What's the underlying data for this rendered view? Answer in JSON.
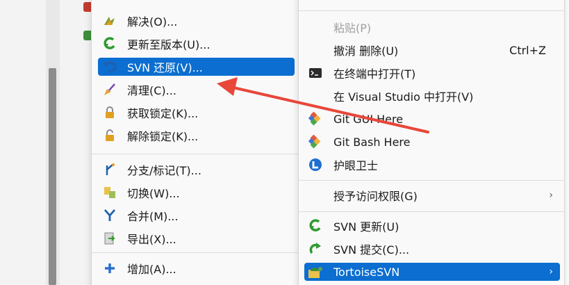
{
  "left_menu": {
    "items": [
      {
        "label": "解决(O)...",
        "icon": "resolve-icon"
      },
      {
        "label": "更新至版本(U)...",
        "icon": "update-to-revision-icon"
      },
      {
        "label": "SVN 还原(V)...",
        "icon": "revert-icon",
        "highlighted": true
      },
      {
        "label": "清理(C)...",
        "icon": "cleanup-broom-icon"
      },
      {
        "label": "获取锁定(K)...",
        "icon": "lock-icon"
      },
      {
        "label": "解除锁定(K)...",
        "icon": "unlock-icon"
      },
      {
        "label": "分支/标记(T)...",
        "icon": "branch-tag-icon"
      },
      {
        "label": "切换(W)...",
        "icon": "switch-icon"
      },
      {
        "label": "合并(M)...",
        "icon": "merge-icon"
      },
      {
        "label": "导出(X)...",
        "icon": "export-icon"
      },
      {
        "label": "增加(A)...",
        "icon": "add-plus-icon"
      }
    ]
  },
  "right_menu": {
    "items": [
      {
        "label": "粘贴(P)",
        "disabled": true
      },
      {
        "label": "撤消 删除(U)",
        "shortcut": "Ctrl+Z"
      },
      {
        "label": "在终端中打开(T)",
        "icon": "terminal-icon"
      },
      {
        "label": "在 Visual Studio 中打开(V)"
      },
      {
        "label": "Git GUI Here",
        "icon": "git-icon"
      },
      {
        "label": "Git Bash Here",
        "icon": "git-icon"
      },
      {
        "label": "护眼卫士",
        "icon": "eye-guard-icon"
      },
      {
        "label": "授予访问权限(G)",
        "submenu": true
      },
      {
        "label": "SVN 更新(U)",
        "icon": "svn-update-icon"
      },
      {
        "label": "SVN 提交(C)...",
        "icon": "svn-commit-icon"
      },
      {
        "label": "TortoiseSVN",
        "icon": "tortoisesvn-icon",
        "highlighted": true,
        "submenu": true
      }
    ],
    "arrow_glyph": "›"
  },
  "colors": {
    "highlight": "#0b6ed0",
    "annotation_arrow": "#e8473a"
  }
}
